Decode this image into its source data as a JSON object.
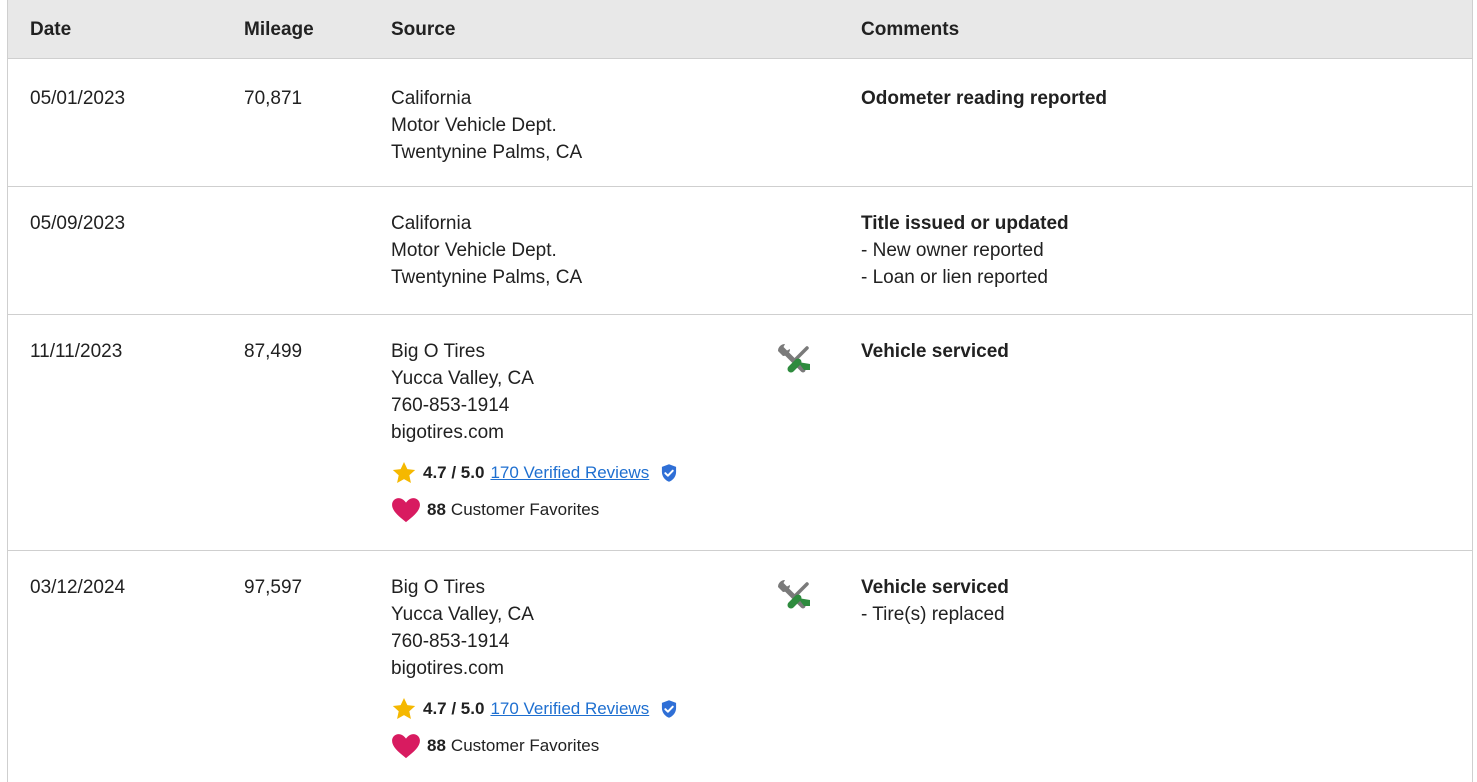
{
  "header": {
    "date": "Date",
    "mileage": "Mileage",
    "source": "Source",
    "comments": "Comments"
  },
  "rows": [
    {
      "date": "05/01/2023",
      "mileage": "70,871",
      "source": [
        "California",
        "Motor Vehicle Dept.",
        "Twentynine Palms, CA"
      ],
      "comment_title": "Odometer reading reported",
      "comment_items": []
    },
    {
      "date": "05/09/2023",
      "mileage": "",
      "source": [
        "California",
        "Motor Vehicle Dept.",
        "Twentynine Palms, CA"
      ],
      "comment_title": "Title issued or updated",
      "comment_items": [
        "- New owner reported",
        "- Loan or lien reported"
      ]
    },
    {
      "date": "11/11/2023",
      "mileage": "87,499",
      "source": [
        "Big O Tires",
        "Yucca Valley, CA",
        "760-853-1914",
        "bigotires.com"
      ],
      "rating": "4.7 / 5.0",
      "reviews_link": "170 Verified Reviews",
      "favorites_count": "88",
      "favorites_label": "Customer Favorites",
      "icon": "service-wrench-screwdriver-icon",
      "comment_title": "Vehicle serviced",
      "comment_items": []
    },
    {
      "date": "03/12/2024",
      "mileage": "97,597",
      "source": [
        "Big O Tires",
        "Yucca Valley, CA",
        "760-853-1914",
        "bigotires.com"
      ],
      "rating": "4.7 / 5.0",
      "reviews_link": "170 Verified Reviews",
      "favorites_count": "88",
      "favorites_label": "Customer Favorites",
      "icon": "service-wrench-screwdriver-icon",
      "comment_title": "Vehicle serviced",
      "comment_items": [
        "- Tire(s) replaced"
      ]
    }
  ],
  "colors": {
    "header_bg": "#e8e8e8",
    "border": "#cfcfcf",
    "link": "#1e6fd0",
    "star": "#f5b800",
    "heart": "#d81b60",
    "verified": "#2f6fd6",
    "service_green": "#2e8b3e"
  }
}
